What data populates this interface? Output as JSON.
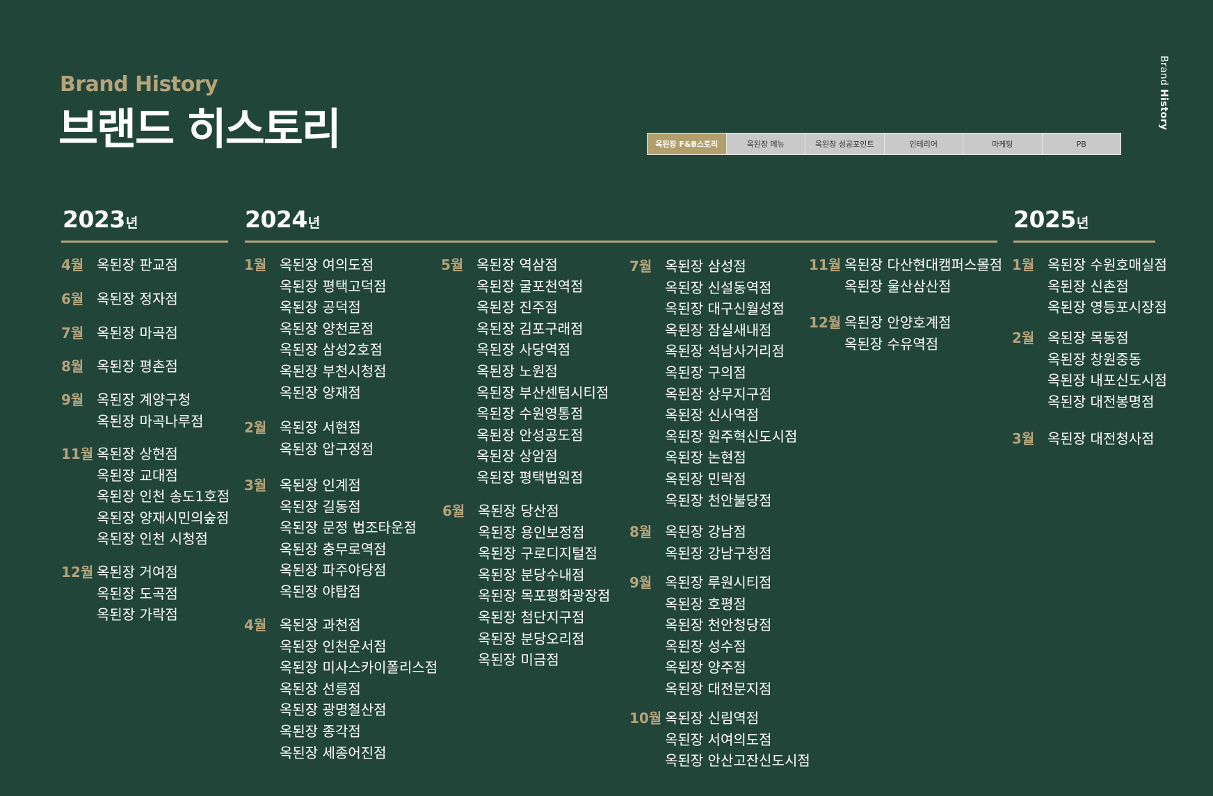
{
  "header": {
    "eyebrow": "Brand History",
    "title": "브랜드 히스토리",
    "side_label_regular": "Brand ",
    "side_label_bold": "History"
  },
  "tabs": [
    {
      "label": "옥된장 F&B스토리",
      "active": true
    },
    {
      "label": "옥된장 메뉴",
      "active": false
    },
    {
      "label": "옥된장 성공포인트",
      "active": false
    },
    {
      "label": "인테리어",
      "active": false
    },
    {
      "label": "마케팅",
      "active": false
    },
    {
      "label": "PB",
      "active": false
    }
  ],
  "colors": {
    "background": "#22453a",
    "gold": "#b5a47a",
    "tab_active": "#b19f6d",
    "tab_inactive": "#c9c9c9"
  },
  "years": [
    {
      "year": "2023",
      "suffix": "년"
    },
    {
      "year": "2024",
      "suffix": "년"
    },
    {
      "year": "2025",
      "suffix": "년"
    }
  ],
  "groups": [
    {
      "month": "4월",
      "stores": [
        "옥된장 판교점"
      ]
    },
    {
      "month": "6월",
      "stores": [
        "옥된장 정자점"
      ]
    },
    {
      "month": "7월",
      "stores": [
        "옥된장 마곡점"
      ]
    },
    {
      "month": "8월",
      "stores": [
        "옥된장 평촌점"
      ]
    },
    {
      "month": "9월",
      "stores": [
        "옥된장 계양구청",
        "옥된장 마곡나루점"
      ]
    },
    {
      "month": "11월",
      "stores": [
        "옥된장 상현점",
        "옥된장 교대점",
        "옥된장 인천 송도1호점",
        "옥된장 양재시민의숲점",
        "옥된장 인천 시청점"
      ]
    },
    {
      "month": "12월",
      "stores": [
        "옥된장 거여점",
        "옥된장 도곡점",
        "옥된장 가락점"
      ]
    },
    {
      "month": "1월",
      "stores": [
        "옥된장 여의도점",
        "옥된장 평택고덕점",
        "옥된장 공덕점",
        "옥된장 양천로점",
        "옥된장 삼성2호점",
        "옥된장 부천시청점",
        "옥된장 양재점"
      ]
    },
    {
      "month": "2월",
      "stores": [
        "옥된장 서현점",
        "옥된장 압구정점"
      ]
    },
    {
      "month": "3월",
      "stores": [
        "옥된장 인계점",
        "옥된장 길동점",
        "옥된장 문정 법조타운점",
        "옥된장 충무로역점",
        "옥된장 파주야당점",
        "옥된장 야탑점"
      ]
    },
    {
      "month": "4월",
      "stores": [
        "옥된장 과천점",
        "옥된장 인천운서점",
        "옥된장 미사스카이폴리스점",
        "옥된장 선릉점",
        "옥된장 광명철산점",
        "옥된장 종각점",
        "옥된장 세종어진점"
      ]
    },
    {
      "month": "5월",
      "stores": [
        "옥된장 역삼점",
        "옥된장 굴포천역점",
        "옥된장 진주점",
        "옥된장 김포구래점",
        "옥된장 사당역점",
        "옥된장 노원점",
        "옥된장 부산센텀시티점",
        "옥된장 수원영통점",
        "옥된장 안성공도점",
        "옥된장 상암점",
        "옥된장 평택법원점"
      ]
    },
    {
      "month": "6월",
      "stores": [
        "옥된장 당산점",
        "옥된장 용인보정점",
        "옥된장 구로디지털점",
        "옥된장 분당수내점",
        "옥된장 목포평화광장점",
        "옥된장 첨단지구점",
        " 옥된장 분당오리점",
        "옥된장 미금점"
      ]
    },
    {
      "month": "7월",
      "stores": [
        "옥된장 삼성점",
        "옥된장 신설동역점",
        "옥된장 대구신월성점",
        "옥된장 잠실새내점",
        "옥된장 석남사거리점",
        "옥된장 구의점",
        "옥된장 상무지구점",
        "옥된장 신사역점",
        "옥된장 원주혁신도시점",
        "옥된장 논현점",
        "옥된장 민락점",
        "옥된장 천안불당점"
      ]
    },
    {
      "month": "8월",
      "stores": [
        "옥된장 강남점",
        "옥된장 강남구청점"
      ]
    },
    {
      "month": "9월",
      "stores": [
        "옥된장 루원시티점",
        "옥된장 호평점",
        "옥된장 천안청당점",
        "옥된장 성수점",
        "옥된장 양주점",
        "옥된장 대전문지점"
      ]
    },
    {
      "month": "10월",
      "stores": [
        "옥된장 신림역점",
        "옥된장 서여의도점",
        "옥된장  안산고잔신도시점"
      ]
    },
    {
      "month": "11월",
      "stores": [
        "옥된장 다산현대캠퍼스몰점",
        "옥된장 울산삼산점"
      ]
    },
    {
      "month": "12월",
      "stores": [
        "옥된장 안양호계점",
        "옥된장 수유역점"
      ]
    },
    {
      "month": "1월",
      "stores": [
        "옥된장 수원호매실점",
        "옥된장 신촌점",
        "옥된장 영등포시장점"
      ]
    },
    {
      "month": "2월",
      "stores": [
        "옥된장 목동점",
        "옥된장 창원중동",
        "옥된장 내포신도시점",
        "옥된장 대전봉명점"
      ]
    },
    {
      "month": "3월",
      "stores": [
        "옥된장 대전청사점"
      ]
    }
  ]
}
